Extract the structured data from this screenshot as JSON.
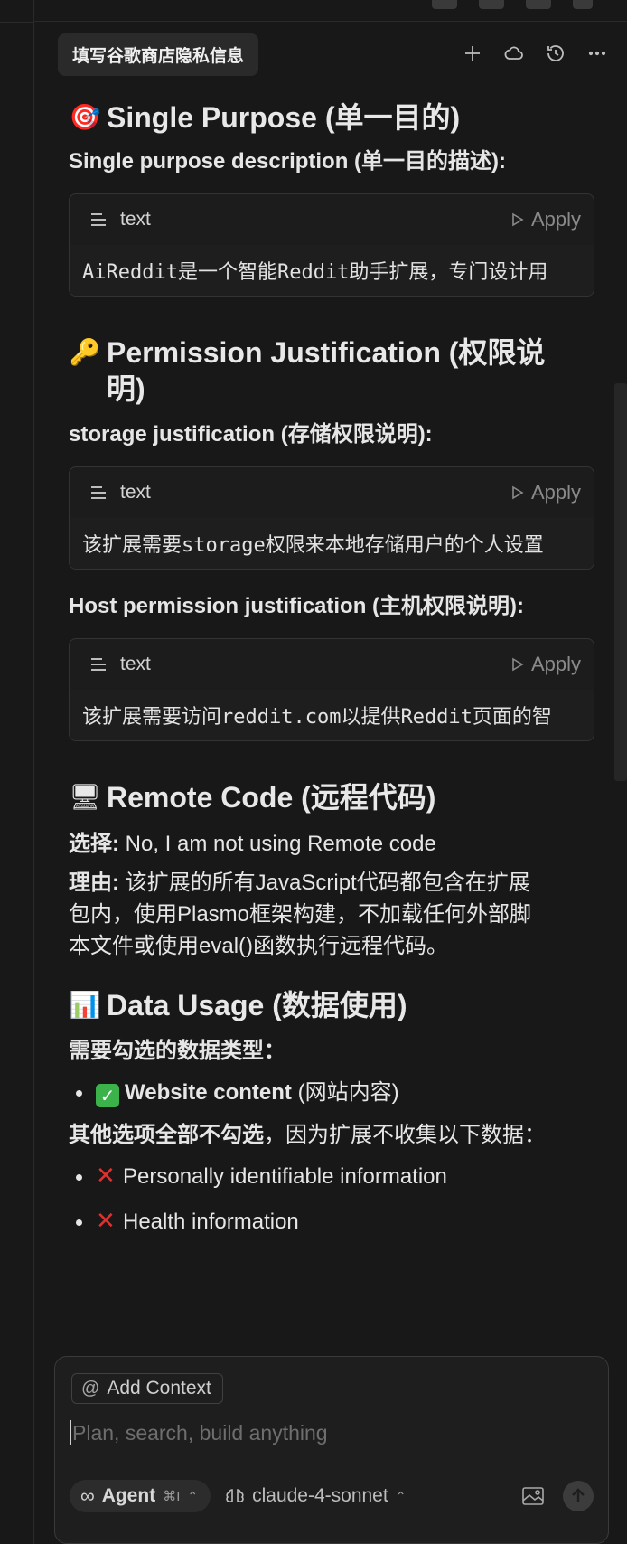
{
  "chat": {
    "title": "填写谷歌商店隐私信息"
  },
  "sections": {
    "single_purpose": {
      "emoji": "🎯",
      "heading": "Single Purpose (单一目的)",
      "sub": "Single purpose description (单一目的描述):",
      "block": {
        "lang": "text",
        "apply": "Apply",
        "code": "AiReddit是一个智能Reddit助手扩展，专门设计用"
      }
    },
    "permission": {
      "emoji": "🔑",
      "heading_1": "Permission Justification (权限说",
      "heading_2": "明)",
      "storage_sub": "storage justification (存储权限说明):",
      "storage_block": {
        "lang": "text",
        "apply": "Apply",
        "code": "该扩展需要storage权限来本地存储用户的个人设置"
      },
      "host_sub": "Host permission justification (主机权限说明):",
      "host_block": {
        "lang": "text",
        "apply": "Apply",
        "code": "该扩展需要访问reddit.com以提供Reddit页面的智"
      }
    },
    "remote": {
      "emoji": "🖥",
      "heading": "Remote Code (远程代码)",
      "choice_label": "选择:",
      "choice_value": " No, I am not using Remote code",
      "reason_label": "理由:",
      "reason_1": " 该扩展的所有JavaScript代码都包含在扩展",
      "reason_2": "包内，使用Plasmo框架构建，不加载任何外部脚",
      "reason_3": "本文件或使用eval()函数执行远程代码。"
    },
    "data_usage": {
      "emoji": "📊",
      "heading": "Data Usage (数据使用)",
      "need_label": "需要勾选的数据类型：",
      "need_item_bold": "Website content",
      "need_item_rest": " (网站内容)",
      "other_label": "其他选项全部不勾选",
      "other_rest": "，因为扩展不收集以下数据：",
      "not_items": [
        "Personally identifiable information",
        "Health information"
      ]
    }
  },
  "composer": {
    "add_context": "Add Context",
    "placeholder": "Plan, search, build anything",
    "mode": "Agent",
    "mode_shortcut": "⌘I",
    "model": "claude-4-sonnet"
  }
}
